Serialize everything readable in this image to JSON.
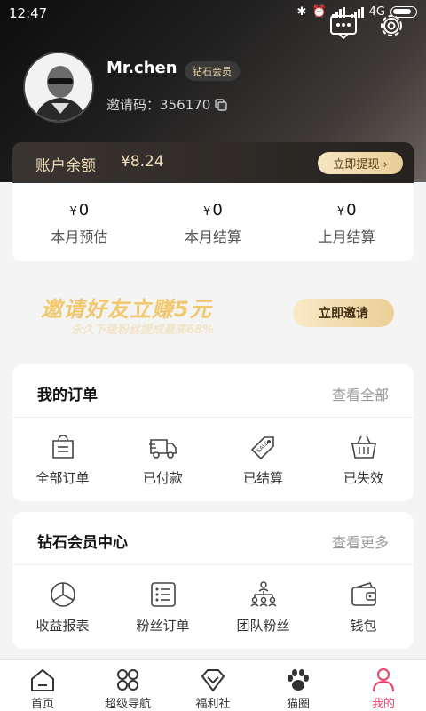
{
  "status_bar": {
    "time": "12:47",
    "network": "4G"
  },
  "profile": {
    "username": "Mr.chen",
    "badge": "钻石会员",
    "invite_label": "邀请码：",
    "invite_code": "356170"
  },
  "balance": {
    "label": "账户余额",
    "value": "¥8.24",
    "withdraw_label": "立即提现 ›"
  },
  "stats": [
    {
      "currency": "¥",
      "value": "0",
      "label": "本月预估"
    },
    {
      "currency": "¥",
      "value": "0",
      "label": "本月结算"
    },
    {
      "currency": "¥",
      "value": "0",
      "label": "上月结算"
    }
  ],
  "banner": {
    "title": "邀请好友立赚5元",
    "subtitle": "永久下级粉丝提成最高68%",
    "button": "立即邀请"
  },
  "orders": {
    "title": "我的订单",
    "more": "查看全部",
    "items": [
      {
        "label": "全部订单",
        "icon": "bag-icon"
      },
      {
        "label": "已付款",
        "icon": "truck-icon"
      },
      {
        "label": "已结算",
        "icon": "tag-icon"
      },
      {
        "label": "已失效",
        "icon": "basket-icon"
      }
    ]
  },
  "vip_center": {
    "title": "钻石会员中心",
    "more": "查看更多",
    "items": [
      {
        "label": "收益报表",
        "icon": "pie-chart-icon"
      },
      {
        "label": "粉丝订单",
        "icon": "list-icon"
      },
      {
        "label": "团队粉丝",
        "icon": "team-icon"
      },
      {
        "label": "钱包",
        "icon": "wallet-icon"
      }
    ]
  },
  "tabbar": {
    "items": [
      {
        "label": "首页",
        "icon": "home-icon"
      },
      {
        "label": "超级导航",
        "icon": "grid-icon"
      },
      {
        "label": "福利社",
        "icon": "diamond-icon"
      },
      {
        "label": "猫圈",
        "icon": "paw-icon"
      },
      {
        "label": "我的",
        "icon": "user-icon"
      }
    ],
    "active_index": 4
  },
  "colors": {
    "accent": "#ee3f6a",
    "gold": "#f1dfb8",
    "dark": "#1f1f1f"
  }
}
